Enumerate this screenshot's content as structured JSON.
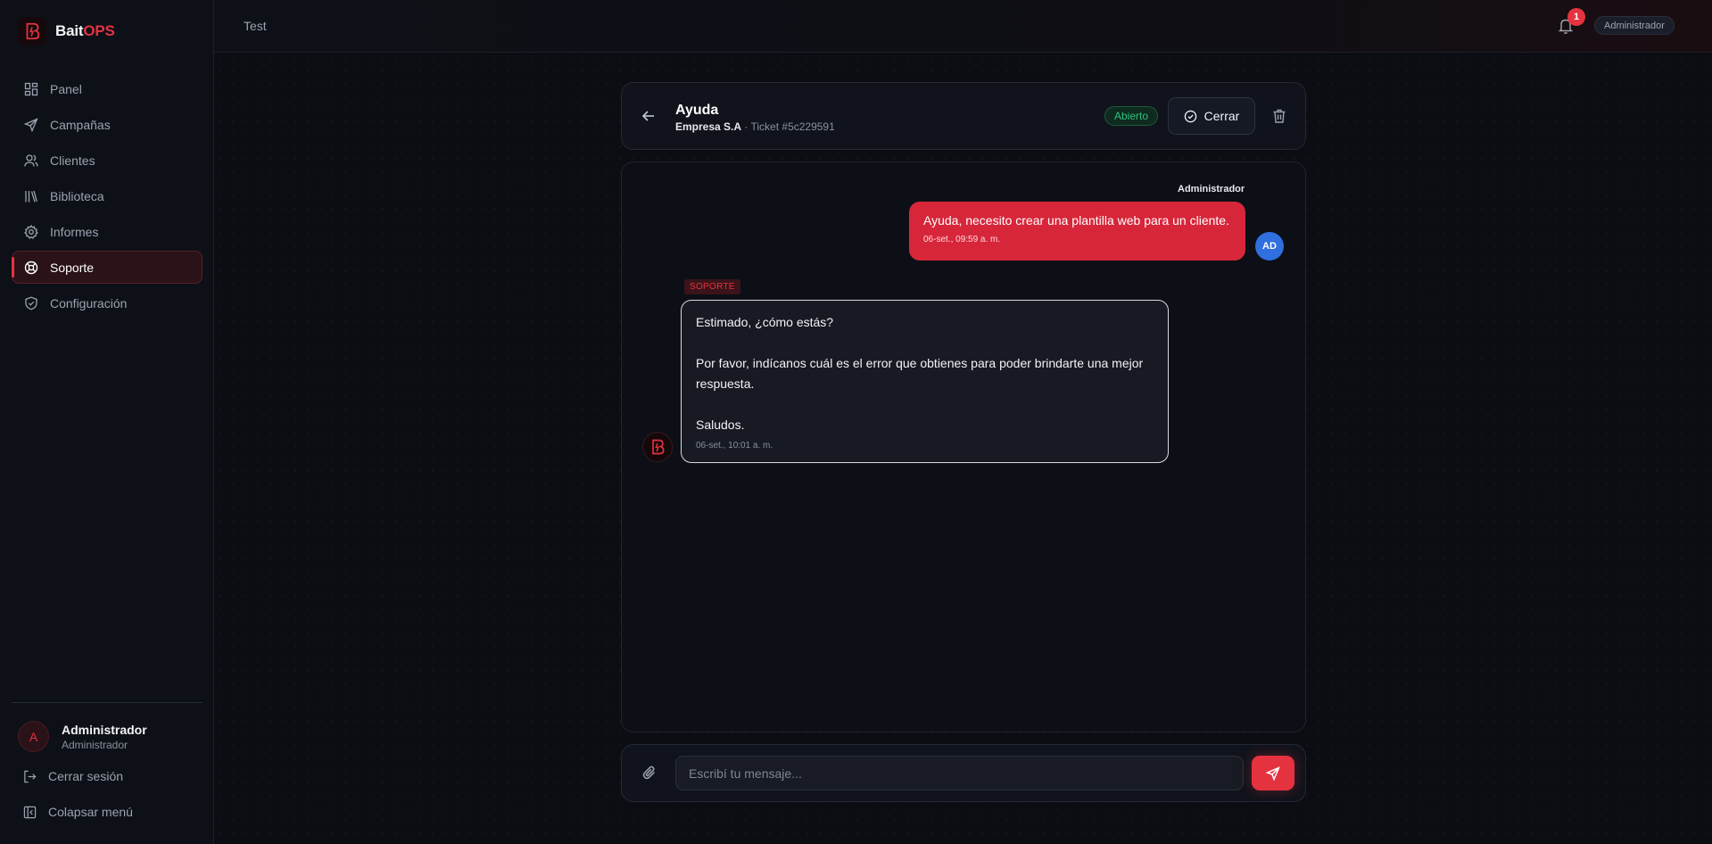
{
  "brand": {
    "name_main": "Bait",
    "name_accent": "OPS"
  },
  "sidebar": {
    "items": [
      {
        "label": "Panel",
        "icon": "grid-icon"
      },
      {
        "label": "Campañas",
        "icon": "send-icon"
      },
      {
        "label": "Clientes",
        "icon": "users-icon"
      },
      {
        "label": "Biblioteca",
        "icon": "library-icon"
      },
      {
        "label": "Informes",
        "icon": "gear-icon"
      },
      {
        "label": "Soporte",
        "icon": "lifebuoy-icon",
        "active": true
      },
      {
        "label": "Configuración",
        "icon": "shield-icon"
      }
    ],
    "user": {
      "initial": "A",
      "name": "Administrador",
      "role": "Administrador"
    },
    "logout_label": "Cerrar sesión",
    "collapse_label": "Colapsar menú"
  },
  "topbar": {
    "title": "Test",
    "notification_count": "1",
    "role": "Administrador"
  },
  "ticket": {
    "title": "Ayuda",
    "company": "Empresa S.A",
    "separator": " · ",
    "ticket_label": "Ticket #5c229591",
    "status": "Abierto",
    "close_label": "Cerrar"
  },
  "messages": {
    "outgoing": {
      "sender": "Administrador",
      "text": "Ayuda, necesito crear una plantilla web para un cliente.",
      "time": "06-set., 09:59 a. m.",
      "avatar_initials": "AD"
    },
    "incoming": {
      "tag": "SOPORTE",
      "line1": "Estimado, ¿cómo estás?",
      "line2": "Por favor, indícanos cuál es el error que obtienes para poder brindarte una mejor",
      "line3": "respuesta.",
      "line4": "Saludos.",
      "time": "06-set., 10:01 a. m."
    }
  },
  "composer": {
    "placeholder": "Escribí tu mensaje..."
  },
  "colors": {
    "accent": "#e5323f",
    "status_open": "#2fc27e",
    "avatar_blue": "#2f6fde"
  }
}
